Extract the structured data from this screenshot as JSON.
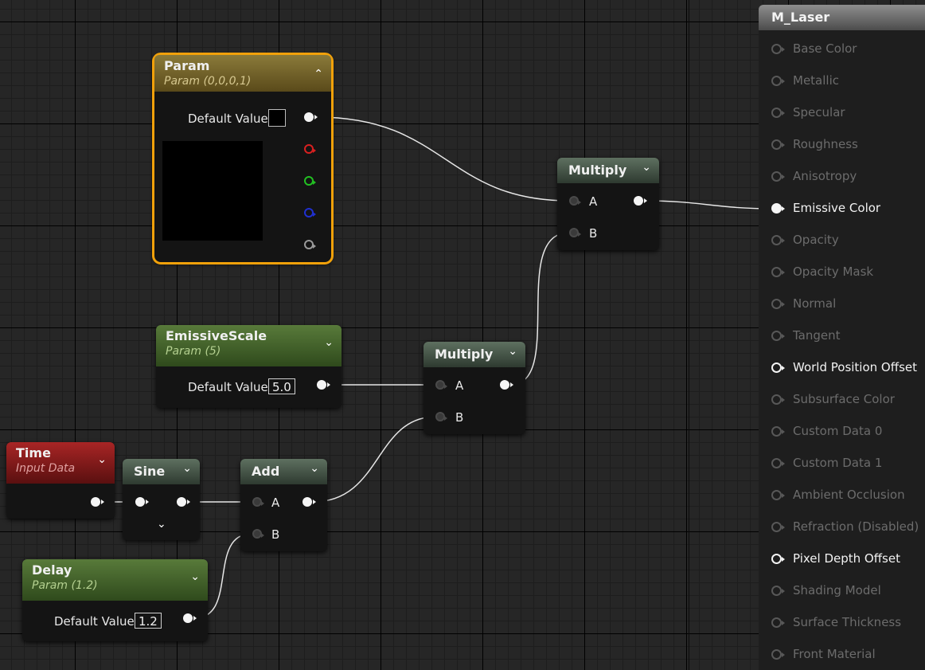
{
  "colors": {
    "selection_outline": "#f1a10a",
    "wire": "#e6e6e6",
    "pin_red": "#d82020",
    "pin_green": "#22c022",
    "pin_blue": "#2030d0",
    "pin_grey": "#9a9a9a"
  },
  "nodes": {
    "param": {
      "title": "Param",
      "subtitle": "Param (0,0,0,1)",
      "default_label": "Default Value"
    },
    "emissive": {
      "title": "EmissiveScale",
      "subtitle": "Param (5)",
      "default_label": "Default Value",
      "value": "5.0"
    },
    "time": {
      "title": "Time",
      "subtitle": "Input Data"
    },
    "sine": {
      "title": "Sine"
    },
    "add": {
      "title": "Add",
      "pin_a": "A",
      "pin_b": "B"
    },
    "delay": {
      "title": "Delay",
      "subtitle": "Param (1.2)",
      "default_label": "Default Value",
      "value": "1.2"
    },
    "multiply_top": {
      "title": "Multiply",
      "pin_a": "A",
      "pin_b": "B"
    },
    "multiply_mid": {
      "title": "Multiply",
      "pin_a": "A",
      "pin_b": "B"
    }
  },
  "result": {
    "title": "M_Laser",
    "inputs": [
      {
        "label": "Base Color",
        "state": "inactive"
      },
      {
        "label": "Metallic",
        "state": "inactive"
      },
      {
        "label": "Specular",
        "state": "inactive"
      },
      {
        "label": "Roughness",
        "state": "inactive"
      },
      {
        "label": "Anisotropy",
        "state": "inactive"
      },
      {
        "label": "Emissive Color",
        "state": "connected"
      },
      {
        "label": "Opacity",
        "state": "inactive"
      },
      {
        "label": "Opacity Mask",
        "state": "inactive"
      },
      {
        "label": "Normal",
        "state": "inactive"
      },
      {
        "label": "Tangent",
        "state": "inactive"
      },
      {
        "label": "World Position Offset",
        "state": "active"
      },
      {
        "label": "Subsurface Color",
        "state": "inactive"
      },
      {
        "label": "Custom Data 0",
        "state": "inactive"
      },
      {
        "label": "Custom Data 1",
        "state": "inactive"
      },
      {
        "label": "Ambient Occlusion",
        "state": "inactive"
      },
      {
        "label": "Refraction (Disabled)",
        "state": "inactive"
      },
      {
        "label": "Pixel Depth Offset",
        "state": "active"
      },
      {
        "label": "Shading Model",
        "state": "inactive"
      },
      {
        "label": "Surface Thickness",
        "state": "inactive"
      },
      {
        "label": "Front Material",
        "state": "inactive"
      }
    ]
  }
}
